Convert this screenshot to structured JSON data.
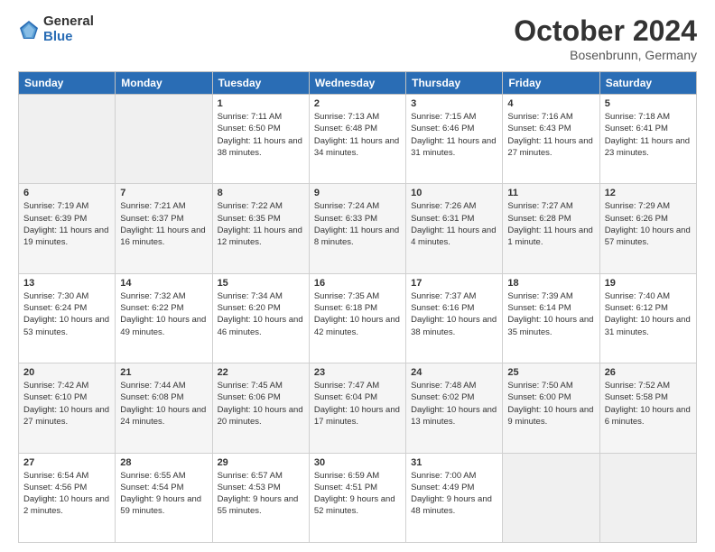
{
  "header": {
    "logo_general": "General",
    "logo_blue": "Blue",
    "month_title": "October 2024",
    "location": "Bosenbrunn, Germany"
  },
  "weekdays": [
    "Sunday",
    "Monday",
    "Tuesday",
    "Wednesday",
    "Thursday",
    "Friday",
    "Saturday"
  ],
  "weeks": [
    [
      {
        "day": "",
        "text": ""
      },
      {
        "day": "",
        "text": ""
      },
      {
        "day": "1",
        "text": "Sunrise: 7:11 AM\nSunset: 6:50 PM\nDaylight: 11 hours and 38 minutes."
      },
      {
        "day": "2",
        "text": "Sunrise: 7:13 AM\nSunset: 6:48 PM\nDaylight: 11 hours and 34 minutes."
      },
      {
        "day": "3",
        "text": "Sunrise: 7:15 AM\nSunset: 6:46 PM\nDaylight: 11 hours and 31 minutes."
      },
      {
        "day": "4",
        "text": "Sunrise: 7:16 AM\nSunset: 6:43 PM\nDaylight: 11 hours and 27 minutes."
      },
      {
        "day": "5",
        "text": "Sunrise: 7:18 AM\nSunset: 6:41 PM\nDaylight: 11 hours and 23 minutes."
      }
    ],
    [
      {
        "day": "6",
        "text": "Sunrise: 7:19 AM\nSunset: 6:39 PM\nDaylight: 11 hours and 19 minutes."
      },
      {
        "day": "7",
        "text": "Sunrise: 7:21 AM\nSunset: 6:37 PM\nDaylight: 11 hours and 16 minutes."
      },
      {
        "day": "8",
        "text": "Sunrise: 7:22 AM\nSunset: 6:35 PM\nDaylight: 11 hours and 12 minutes."
      },
      {
        "day": "9",
        "text": "Sunrise: 7:24 AM\nSunset: 6:33 PM\nDaylight: 11 hours and 8 minutes."
      },
      {
        "day": "10",
        "text": "Sunrise: 7:26 AM\nSunset: 6:31 PM\nDaylight: 11 hours and 4 minutes."
      },
      {
        "day": "11",
        "text": "Sunrise: 7:27 AM\nSunset: 6:28 PM\nDaylight: 11 hours and 1 minute."
      },
      {
        "day": "12",
        "text": "Sunrise: 7:29 AM\nSunset: 6:26 PM\nDaylight: 10 hours and 57 minutes."
      }
    ],
    [
      {
        "day": "13",
        "text": "Sunrise: 7:30 AM\nSunset: 6:24 PM\nDaylight: 10 hours and 53 minutes."
      },
      {
        "day": "14",
        "text": "Sunrise: 7:32 AM\nSunset: 6:22 PM\nDaylight: 10 hours and 49 minutes."
      },
      {
        "day": "15",
        "text": "Sunrise: 7:34 AM\nSunset: 6:20 PM\nDaylight: 10 hours and 46 minutes."
      },
      {
        "day": "16",
        "text": "Sunrise: 7:35 AM\nSunset: 6:18 PM\nDaylight: 10 hours and 42 minutes."
      },
      {
        "day": "17",
        "text": "Sunrise: 7:37 AM\nSunset: 6:16 PM\nDaylight: 10 hours and 38 minutes."
      },
      {
        "day": "18",
        "text": "Sunrise: 7:39 AM\nSunset: 6:14 PM\nDaylight: 10 hours and 35 minutes."
      },
      {
        "day": "19",
        "text": "Sunrise: 7:40 AM\nSunset: 6:12 PM\nDaylight: 10 hours and 31 minutes."
      }
    ],
    [
      {
        "day": "20",
        "text": "Sunrise: 7:42 AM\nSunset: 6:10 PM\nDaylight: 10 hours and 27 minutes."
      },
      {
        "day": "21",
        "text": "Sunrise: 7:44 AM\nSunset: 6:08 PM\nDaylight: 10 hours and 24 minutes."
      },
      {
        "day": "22",
        "text": "Sunrise: 7:45 AM\nSunset: 6:06 PM\nDaylight: 10 hours and 20 minutes."
      },
      {
        "day": "23",
        "text": "Sunrise: 7:47 AM\nSunset: 6:04 PM\nDaylight: 10 hours and 17 minutes."
      },
      {
        "day": "24",
        "text": "Sunrise: 7:48 AM\nSunset: 6:02 PM\nDaylight: 10 hours and 13 minutes."
      },
      {
        "day": "25",
        "text": "Sunrise: 7:50 AM\nSunset: 6:00 PM\nDaylight: 10 hours and 9 minutes."
      },
      {
        "day": "26",
        "text": "Sunrise: 7:52 AM\nSunset: 5:58 PM\nDaylight: 10 hours and 6 minutes."
      }
    ],
    [
      {
        "day": "27",
        "text": "Sunrise: 6:54 AM\nSunset: 4:56 PM\nDaylight: 10 hours and 2 minutes."
      },
      {
        "day": "28",
        "text": "Sunrise: 6:55 AM\nSunset: 4:54 PM\nDaylight: 9 hours and 59 minutes."
      },
      {
        "day": "29",
        "text": "Sunrise: 6:57 AM\nSunset: 4:53 PM\nDaylight: 9 hours and 55 minutes."
      },
      {
        "day": "30",
        "text": "Sunrise: 6:59 AM\nSunset: 4:51 PM\nDaylight: 9 hours and 52 minutes."
      },
      {
        "day": "31",
        "text": "Sunrise: 7:00 AM\nSunset: 4:49 PM\nDaylight: 9 hours and 48 minutes."
      },
      {
        "day": "",
        "text": ""
      },
      {
        "day": "",
        "text": ""
      }
    ]
  ]
}
